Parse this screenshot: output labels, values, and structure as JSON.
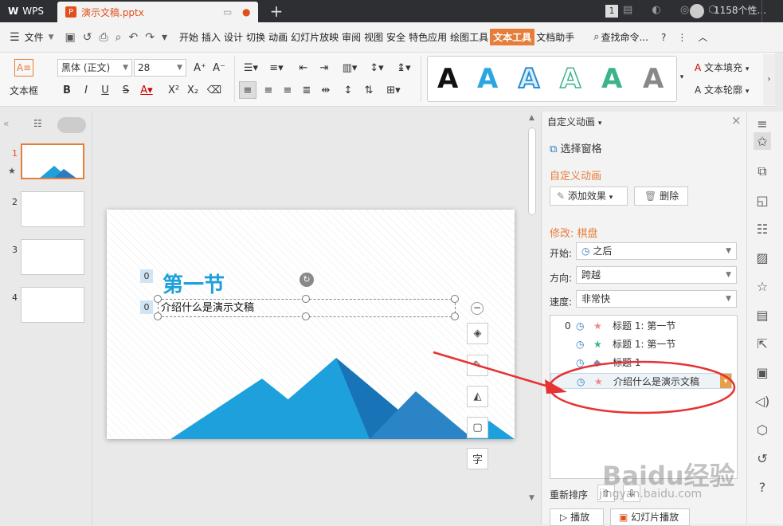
{
  "titlebar": {
    "app_name": "WPS",
    "doc_tab": "演示文稿.pptx",
    "ppt_badge": "P",
    "new_tab": "+",
    "badge_count": "1",
    "user": "1158个性..."
  },
  "menubar": {
    "file": "文件",
    "items": [
      "开始",
      "插入",
      "设计",
      "切换",
      "动画",
      "幻灯片放映",
      "审阅",
      "视图",
      "安全",
      "特色应用",
      "绘图工具",
      "文本工具",
      "文档助手"
    ],
    "active_item": "文本工具",
    "search": "查找命令..."
  },
  "toolbar": {
    "textbox_label": "文本框",
    "font_name": "黑体 (正文)",
    "font_size": "28",
    "text_fill": "文本填充",
    "text_outline": "文本轮廓"
  },
  "thumbs": {
    "numbers": [
      "1",
      "2",
      "3",
      "4"
    ]
  },
  "slide": {
    "title": "第一节",
    "subtitle": "介绍什么是演示文稿",
    "anim_badge_title": "0",
    "anim_badge_sub": "0"
  },
  "float_tools": {
    "font_btn": "字"
  },
  "anim_panel": {
    "header": "自定义动画",
    "selection_pane": "选择窗格",
    "section_title": "自定义动画",
    "add_effect": "添加效果",
    "delete": "删除",
    "modify_label": "修改: 棋盘",
    "start_label": "开始:",
    "start_value": "之后",
    "direction_label": "方向:",
    "direction_value": "跨越",
    "speed_label": "速度:",
    "speed_value": "非常快",
    "items": [
      {
        "index": "0",
        "text": "标题 1: 第一节"
      },
      {
        "index": "",
        "text": "标题 1: 第一节"
      },
      {
        "index": "",
        "text": "标题 1"
      },
      {
        "index": "",
        "text": "介绍什么是演示文稿"
      }
    ],
    "reorder": "重新排序",
    "play": "播放",
    "slideshow": "幻灯片播放"
  },
  "watermark": {
    "text": "Baidu经验",
    "url": "jingyan.baidu.com"
  },
  "colors": {
    "accent": "#e67e3a",
    "title_blue": "#1ea0dc",
    "annotation_red": "#e63232"
  }
}
